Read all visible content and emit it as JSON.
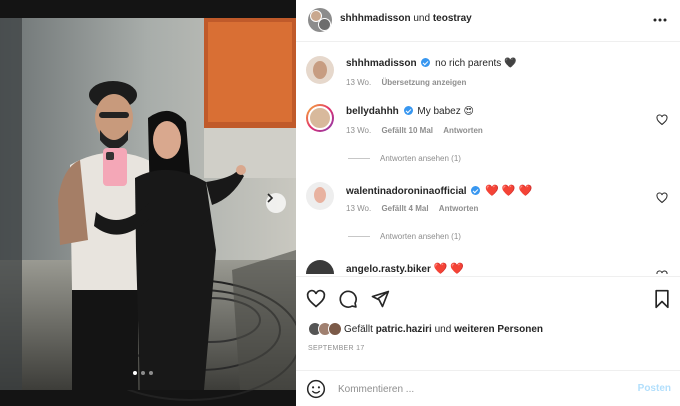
{
  "header": {
    "author": "shhhmadisson",
    "joiner": "und",
    "coauthor": "teostray",
    "more_icon": "more-horizontal-icon"
  },
  "caption": {
    "username": "shhhmadisson",
    "text": "no rich parents",
    "emoji": "🖤",
    "time": "13 Wo.",
    "translate": "Übersetzung anzeigen"
  },
  "comments": [
    {
      "username": "bellydahhh",
      "text": "My babez",
      "emoji": "😍",
      "time": "13 Wo.",
      "likes": "Gefällt 10 Mal",
      "reply": "Antworten",
      "view_replies": "Antworten ansehen (1)"
    },
    {
      "username": "walentinadoroninaofficial",
      "text": "",
      "emoji": "❤️ ❤️ ❤️",
      "time": "13 Wo.",
      "likes": "Gefällt 4 Mal",
      "reply": "Antworten",
      "view_replies": "Antworten ansehen (1)"
    },
    {
      "username": "angelo.rasty.biker",
      "text": "",
      "emoji": "❤️ ❤️"
    }
  ],
  "likes": {
    "prefix": "Gefällt",
    "user": "patric.haziri",
    "joiner": "und",
    "others": "weiteren Personen"
  },
  "date": "SEPTEMBER 17",
  "composer": {
    "placeholder": "Kommentieren ...",
    "post_label": "Posten"
  },
  "colors": {
    "verified": "#3897f0",
    "post_disabled": "#b2dffc",
    "heart": "#e0245e"
  }
}
